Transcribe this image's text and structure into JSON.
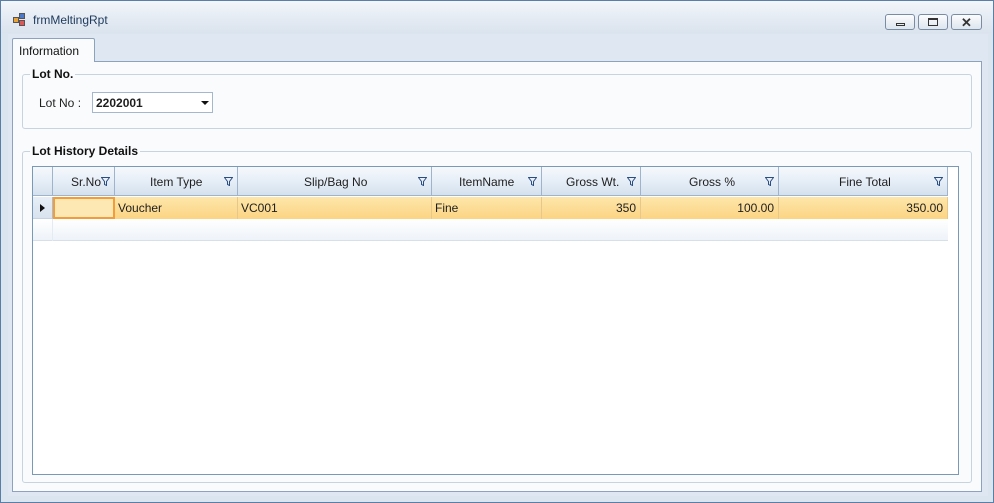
{
  "window": {
    "title": "frmMeltingRpt"
  },
  "tabs": [
    {
      "label": "Information"
    }
  ],
  "lot_group": {
    "title": "Lot No.",
    "label": "Lot No :",
    "value": "2202001"
  },
  "history_group": {
    "title": "Lot History Details",
    "columns": [
      {
        "label": "Sr.No"
      },
      {
        "label": "Item Type"
      },
      {
        "label": "Slip/Bag No"
      },
      {
        "label": "ItemName"
      },
      {
        "label": "Gross Wt."
      },
      {
        "label": "Gross %"
      },
      {
        "label": "Fine Total"
      }
    ],
    "rows": [
      {
        "sr_no": "",
        "item_type": "Voucher",
        "slip_bag_no": "VC001",
        "item_name": "Fine",
        "gross_wt": "350",
        "gross_pct": "100.00",
        "fine_total": "350.00"
      }
    ]
  },
  "colors": {
    "selected_row": "#fcd483",
    "selected_cell_border": "#f39c3c",
    "header_bg": "#dbe6f2"
  },
  "icons": [
    "app-form-icon",
    "minimize-icon",
    "maximize-icon",
    "close-icon",
    "filter-icon",
    "row-indicator-icon",
    "dropdown-arrow-icon"
  ]
}
